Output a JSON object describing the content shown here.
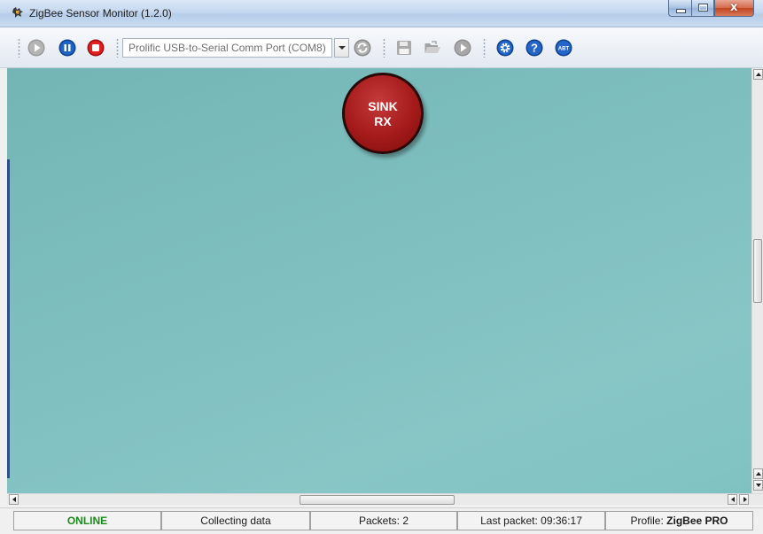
{
  "window": {
    "title": "ZigBee Sensor Monitor (1.2.0)",
    "controls": {
      "minimize": "minimize",
      "maximize": "maximize",
      "close": "x"
    }
  },
  "toolbar": {
    "buttons": [
      {
        "name": "start-button",
        "icon": "play-icon"
      },
      {
        "name": "pause-button",
        "icon": "pause-icon"
      },
      {
        "name": "stop-button",
        "icon": "stop-icon"
      },
      {
        "name": "refresh-ports-button",
        "icon": "refresh-icon"
      },
      {
        "name": "save-log-button",
        "icon": "floppy-save-icon"
      },
      {
        "name": "open-log-button",
        "icon": "folder-open-icon"
      },
      {
        "name": "play-log-button",
        "icon": "play-icon"
      },
      {
        "name": "settings-button",
        "icon": "gear-icon"
      },
      {
        "name": "help-button",
        "icon": "help-question-icon"
      },
      {
        "name": "about-button",
        "icon": "about-icon",
        "text": "ABT"
      }
    ],
    "port_select": {
      "value": "Prolific USB-to-Serial Comm Port (COM8)"
    }
  },
  "canvas": {
    "background": "#7fbfbf",
    "sink_node": {
      "line1": "SINK",
      "line2": "RX",
      "color": "#a41a1a"
    }
  },
  "status": {
    "connection": "ONLINE",
    "connection_color": "#1d8a1d",
    "state": "Collecting data",
    "packets": "Packets: 2",
    "last_packet": "Last packet: 09:36:17",
    "profile_label": "Profile: ",
    "profile_value": "ZigBee PRO"
  }
}
